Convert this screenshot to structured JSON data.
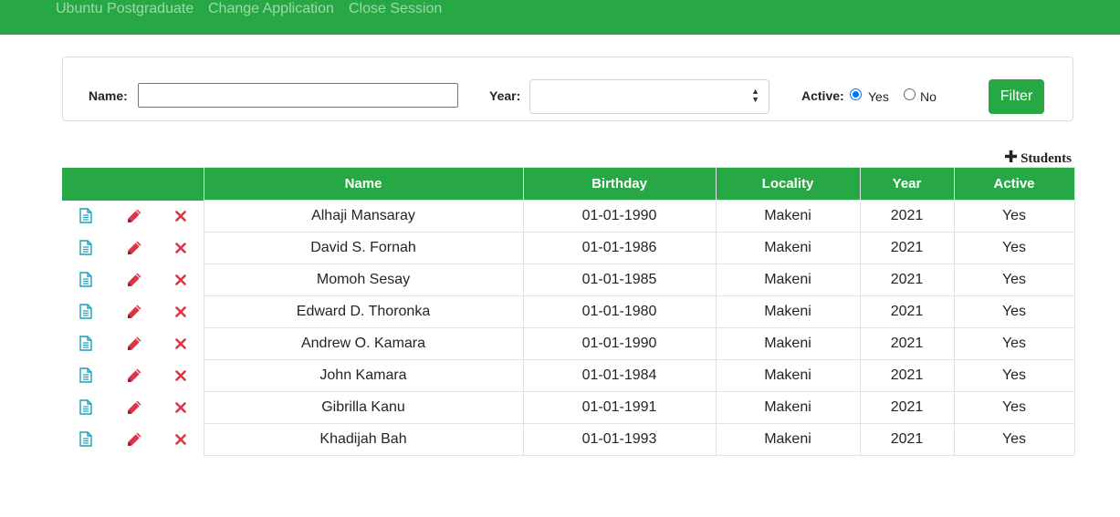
{
  "navbar": {
    "links": [
      "Ubuntu Postgraduate",
      "Change Application",
      "Close Session"
    ]
  },
  "filter": {
    "name_label": "Name:",
    "name_value": "",
    "year_label": "Year:",
    "year_value": "",
    "active_label": "Active:",
    "active_options": [
      "Yes",
      "No"
    ],
    "active_selected": "Yes",
    "button_label": "Filter"
  },
  "add_students_label": "Students",
  "table": {
    "columns": [
      "Name",
      "Birthday",
      "Locality",
      "Year",
      "Active"
    ],
    "rows": [
      {
        "name": "Alhaji Mansaray",
        "birthday": "01-01-1990",
        "locality": "Makeni",
        "year": "2021",
        "active": "Yes"
      },
      {
        "name": "David S. Fornah",
        "birthday": "01-01-1986",
        "locality": "Makeni",
        "year": "2021",
        "active": "Yes"
      },
      {
        "name": "Momoh Sesay",
        "birthday": "01-01-1985",
        "locality": "Makeni",
        "year": "2021",
        "active": "Yes"
      },
      {
        "name": "Edward D. Thoronka",
        "birthday": "01-01-1980",
        "locality": "Makeni",
        "year": "2021",
        "active": "Yes"
      },
      {
        "name": "Andrew O. Kamara",
        "birthday": "01-01-1990",
        "locality": "Makeni",
        "year": "2021",
        "active": "Yes"
      },
      {
        "name": "John Kamara",
        "birthday": "01-01-1984",
        "locality": "Makeni",
        "year": "2021",
        "active": "Yes"
      },
      {
        "name": "Gibrilla Kanu",
        "birthday": "01-01-1991",
        "locality": "Makeni",
        "year": "2021",
        "active": "Yes"
      },
      {
        "name": "Khadijah Bah",
        "birthday": "01-01-1993",
        "locality": "Makeni",
        "year": "2021",
        "active": "Yes"
      }
    ],
    "row_actions": [
      "file-text-icon",
      "pencil-icon",
      "times-icon"
    ]
  },
  "colors": {
    "brand_green": "#28a745",
    "view_icon": "#17a2b8",
    "edit_delete_icon": "#dc3545",
    "radio_accent": "#0075ff"
  }
}
